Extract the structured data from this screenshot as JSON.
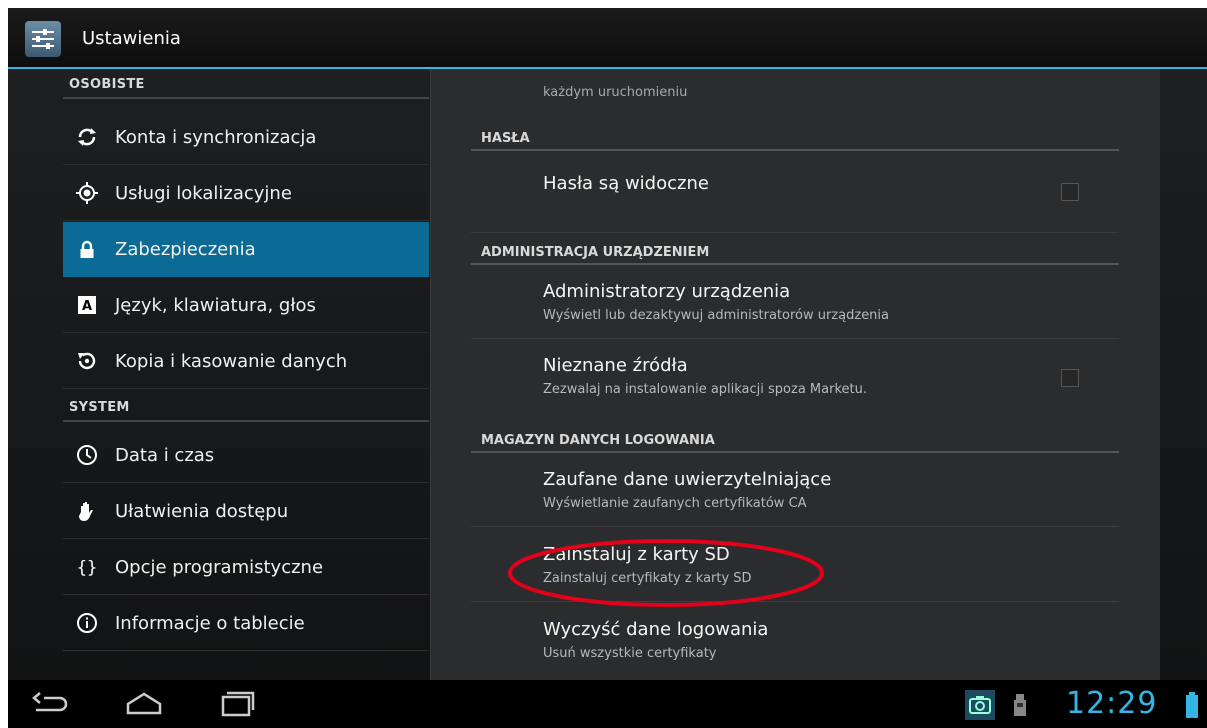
{
  "app": {
    "title": "Ustawienia",
    "icon": "settings-icon"
  },
  "sidebar": {
    "personal_header": "OSOBISTE",
    "system_header": "SYSTEM",
    "items": [
      {
        "label": "Konta i synchronizacja",
        "icon": "sync-icon"
      },
      {
        "label": "Usługi lokalizacyjne",
        "icon": "location-icon"
      },
      {
        "label": "Zabezpieczenia",
        "icon": "lock-icon",
        "selected": true
      },
      {
        "label": "Język, klawiatura, głos",
        "icon": "keyboard-icon"
      },
      {
        "label": "Kopia i kasowanie danych",
        "icon": "backup-icon"
      },
      {
        "label": "Data i czas",
        "icon": "clock-icon"
      },
      {
        "label": "Ułatwienia dostępu",
        "icon": "hand-icon"
      },
      {
        "label": "Opcje programistyczne",
        "icon": "braces-icon"
      },
      {
        "label": "Informacje o tablecie",
        "icon": "info-icon"
      }
    ]
  },
  "detail": {
    "top_summary": "każdym uruchomieniu",
    "sections": {
      "passwords": "HASŁA",
      "device_admin": "ADMINISTRACJA URZĄDZENIEM",
      "credential_storage": "MAGAZYN DANYCH LOGOWANIA"
    },
    "prefs": {
      "show_passwords": {
        "title": "Hasła są widoczne",
        "checked": false
      },
      "device_admins": {
        "title": "Administratorzy urządzenia",
        "summary": "Wyświetl lub dezaktywuj administratorów urządzenia"
      },
      "unknown_sources": {
        "title": "Nieznane źródła",
        "summary": "Zezwalaj na instalowanie aplikacji spoza Marketu.",
        "checked": false
      },
      "trusted_credentials": {
        "title": "Zaufane dane uwierzytelniające",
        "summary": "Wyświetlanie zaufanych certyfikatów CA"
      },
      "install_from_sd": {
        "title": "Zainstaluj z karty SD",
        "summary": "Zainstaluj certyfikaty z karty SD"
      },
      "clear_credentials": {
        "title": "Wyczyść dane logowania",
        "summary": "Usuń wszystkie certyfikaty"
      }
    }
  },
  "status_bar": {
    "time": "12:29"
  },
  "colors": {
    "accent": "#33b5e5",
    "selected": "#0b6b95",
    "highlight_ellipse": "#e2001a"
  }
}
